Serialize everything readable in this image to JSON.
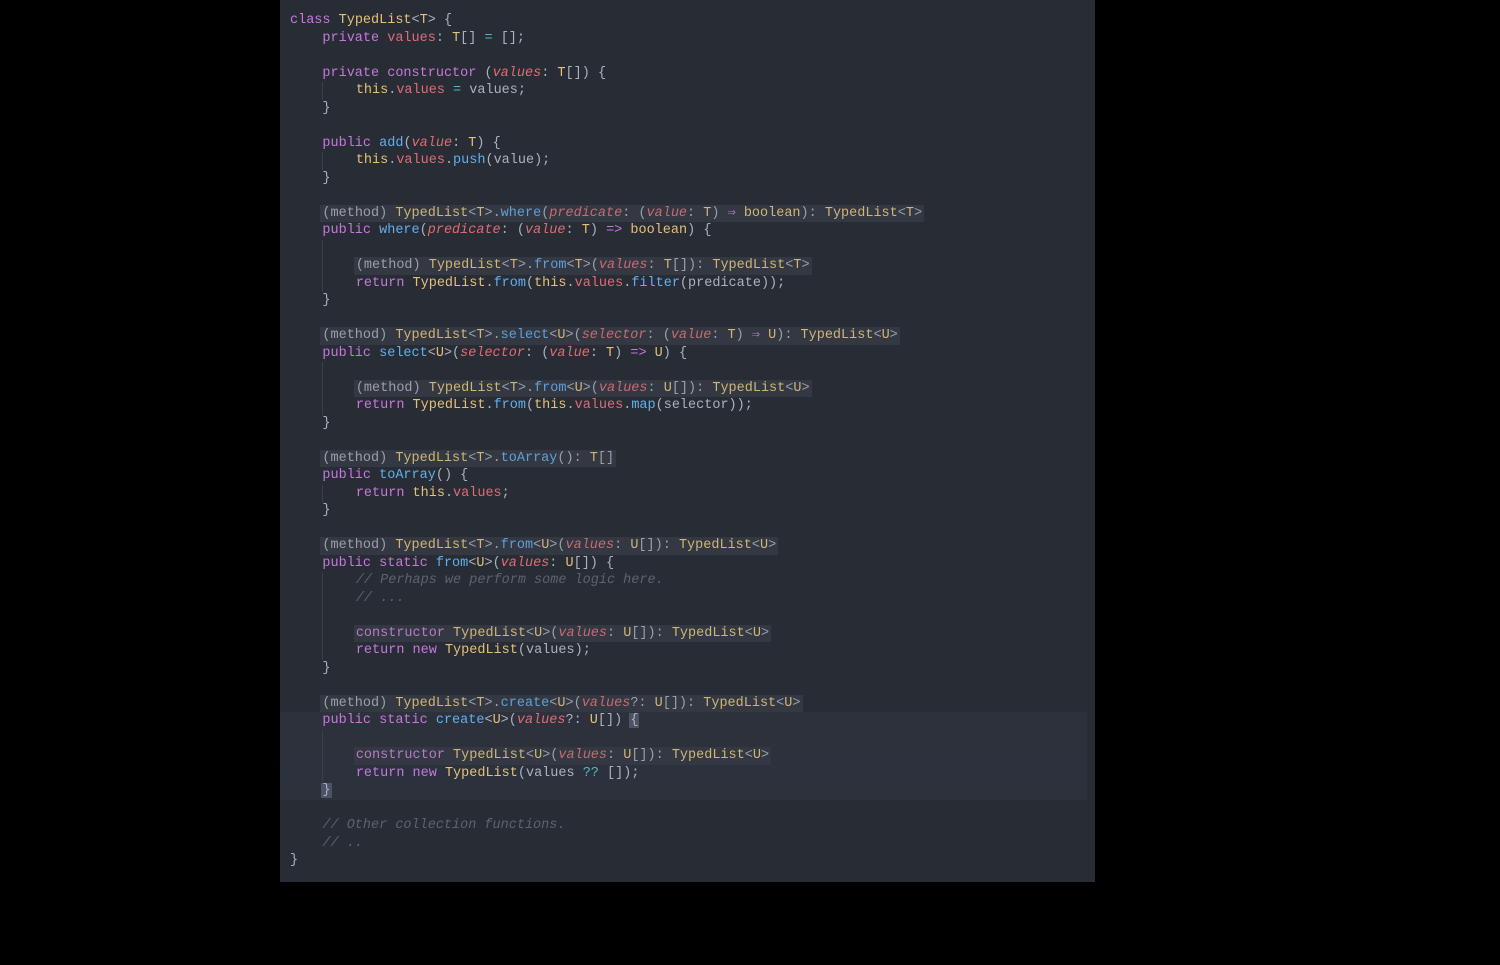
{
  "colors": {
    "background": "#282c34",
    "outer": "#000000",
    "keyword": "#c678dd",
    "type": "#e5c07b",
    "function": "#61afef",
    "property": "#e06c75",
    "operator": "#56b6c2",
    "punctuation": "#abb2bf",
    "comment": "#5c6370",
    "hintBg": "#333842",
    "lineHighlight": "#2c313c"
  },
  "language": "typescript",
  "code_lines": [
    "class TypedList<T> {",
    "    private values: T[] = [];",
    "",
    "    private constructor (values: T[]) {",
    "        this.values = values;",
    "    }",
    "",
    "    public add(value: T) {",
    "        this.values.push(value);",
    "    }",
    "",
    "    public where(predicate: (value: T) => boolean) {",
    "",
    "        return TypedList.from(this.values.filter(predicate));",
    "    }",
    "",
    "    public select<U>(selector: (value: T) => U) {",
    "",
    "        return TypedList.from(this.values.map(selector));",
    "    }",
    "",
    "    public toArray() {",
    "        return this.values;",
    "    }",
    "",
    "    public static from<U>(values: U[]) {",
    "        // Perhaps we perform some logic here.",
    "        // ...",
    "",
    "        return new TypedList(values);",
    "    }",
    "",
    "    public static create<U>(values?: U[]) {",
    "",
    "        return new TypedList(values ?? []);",
    "    }",
    "",
    "    // Other collection functions.",
    "    // ..",
    "}"
  ],
  "inlay_hints": [
    {
      "before_line": "    public where(predicate: (value: T) => boolean) {",
      "text": "(method) TypedList<T>.where(predicate: (value: T) => boolean): TypedList<T>"
    },
    {
      "before_line": "        return TypedList.from(this.values.filter(predicate));",
      "text": "(method) TypedList<T>.from<T>(values: T[]): TypedList<T>"
    },
    {
      "before_line": "    public select<U>(selector: (value: T) => U) {",
      "text": "(method) TypedList<T>.select<U>(selector: (value: T) => U): TypedList<U>"
    },
    {
      "before_line": "        return TypedList.from(this.values.map(selector));",
      "text": "(method) TypedList<T>.from<U>(values: U[]): TypedList<U>"
    },
    {
      "before_line": "    public toArray() {",
      "text": "(method) TypedList<T>.toArray(): T[]"
    },
    {
      "before_line": "    public static from<U>(values: U[]) {",
      "text": "(method) TypedList<T>.from<U>(values: U[]): TypedList<U>"
    },
    {
      "before_line": "        return new TypedList(values);",
      "text": "constructor TypedList<U>(values: U[]): TypedList<U>"
    },
    {
      "before_line": "    public static create<U>(values?: U[]) {",
      "text": "(method) TypedList<T>.create<U>(values?: U[]): TypedList<U>"
    },
    {
      "before_line": "        return new TypedList(values ?? []);",
      "text": "constructor TypedList<U>(values: U[]): TypedList<U>"
    }
  ],
  "active_method": "create",
  "cursor_position": {
    "line_text": "        return new TypedList(values ?? []);",
    "method": "create"
  }
}
